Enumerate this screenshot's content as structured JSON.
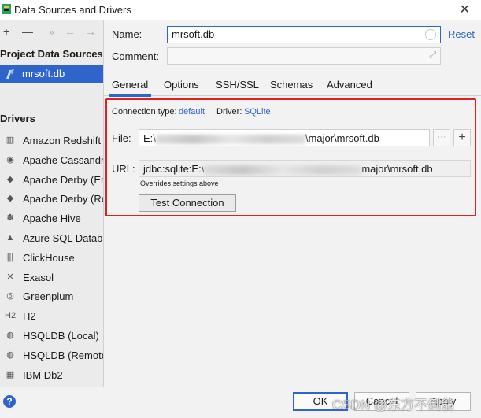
{
  "window": {
    "title": "Data Sources and Drivers"
  },
  "left": {
    "toolbar": {
      "add": "+",
      "remove": "—",
      "more": "»",
      "back": "←",
      "forward": "→"
    },
    "project_header": "Project Data Sources",
    "datasource": "mrsoft.db",
    "drivers_header": "Drivers",
    "drivers": [
      {
        "label": "Amazon Redshift",
        "icon": "▥"
      },
      {
        "label": "Apache Cassandra",
        "icon": "◉"
      },
      {
        "label": "Apache Derby (Embedded)",
        "icon": "◆"
      },
      {
        "label": "Apache Derby (Remote)",
        "icon": "◆"
      },
      {
        "label": "Apache Hive",
        "icon": "✽"
      },
      {
        "label": "Azure SQL Database",
        "icon": "▲"
      },
      {
        "label": "ClickHouse",
        "icon": "|||"
      },
      {
        "label": "Exasol",
        "icon": "✕"
      },
      {
        "label": "Greenplum",
        "icon": "◎"
      },
      {
        "label": "H2",
        "icon": "H2"
      },
      {
        "label": "HSQLDB (Local)",
        "icon": "◍"
      },
      {
        "label": "HSQLDB (Remote)",
        "icon": "◍"
      },
      {
        "label": "IBM Db2",
        "icon": "▦"
      }
    ]
  },
  "form": {
    "name_label": "Name:",
    "name_value": "mrsoft.db",
    "reset": "Reset",
    "comment_label": "Comment:",
    "comment_value": ""
  },
  "tabs": [
    "General",
    "Options",
    "SSH/SSL",
    "Schemas",
    "Advanced"
  ],
  "general": {
    "connection_type_label": "Connection type:",
    "connection_type_value": "default",
    "driver_label": "Driver:",
    "driver_value": "SQLite",
    "file_label": "File:",
    "file_prefix": "E:\\",
    "file_suffix": "\\major\\mrsoft.db",
    "url_label": "URL:",
    "url_prefix": "jdbc:sqlite:E:\\",
    "url_suffix": "major\\mrsoft.db",
    "overrides_note": "Overrides settings above",
    "test_button": "Test Connection"
  },
  "footer": {
    "help": "?",
    "ok": "OK",
    "cancel": "Cancel",
    "apply": "Apply",
    "watermark": "CSDN @东方不倒翁"
  },
  "colors": {
    "accent": "#2f65ca",
    "highlight_border": "#e02020",
    "selection": "#2f65ca"
  }
}
